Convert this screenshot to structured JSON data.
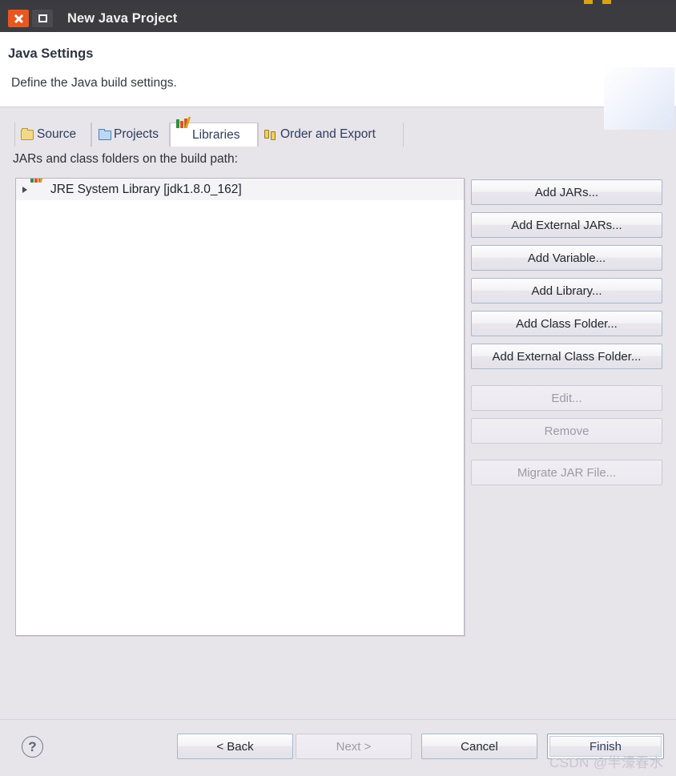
{
  "window": {
    "title": "New Java Project",
    "close_icon": "close-icon",
    "maximize_icon": "maximize-icon"
  },
  "header": {
    "title": "Java Settings",
    "subtitle": "Define the Java build settings.",
    "banner_icon": "java-project-folder-icon"
  },
  "tabs": [
    {
      "label": "Source",
      "icon": "source-folder-icon",
      "selected": false
    },
    {
      "label": "Projects",
      "icon": "projects-folder-icon",
      "selected": false
    },
    {
      "label": "Libraries",
      "icon": "libraries-books-icon",
      "selected": true
    },
    {
      "label": "Order and Export",
      "icon": "order-arrows-icon",
      "selected": false
    }
  ],
  "main": {
    "section_label": "JARs and class folders on the build path:",
    "tree": {
      "rows": [
        {
          "label": "JRE System Library [jdk1.8.0_162]",
          "icon": "libraries-books-icon",
          "expander": "collapsed-arrow-icon"
        }
      ]
    }
  },
  "side_buttons": [
    {
      "label": "Add JARs...",
      "enabled": true
    },
    {
      "label": "Add External JARs...",
      "enabled": true
    },
    {
      "label": "Add Variable...",
      "enabled": true
    },
    {
      "label": "Add Library...",
      "enabled": true
    },
    {
      "label": "Add Class Folder...",
      "enabled": true
    },
    {
      "label": "Add External Class Folder...",
      "enabled": true
    },
    {
      "label": "Edit...",
      "enabled": false
    },
    {
      "label": "Remove",
      "enabled": false
    },
    {
      "label": "Migrate JAR File...",
      "enabled": false
    }
  ],
  "footer": {
    "help_icon": "help-question-icon",
    "back_label": "< Back",
    "next_label": "Next >",
    "cancel_label": "Cancel",
    "finish_label": "Finish"
  },
  "watermark": {
    "text": "CSDN @半濠春水"
  },
  "colors": {
    "dialog_bg": "#e7e4ea",
    "titlebar_bg": "#3c3b40",
    "close_btn": "#e8571f",
    "accent_text": "#2f3d5c"
  }
}
